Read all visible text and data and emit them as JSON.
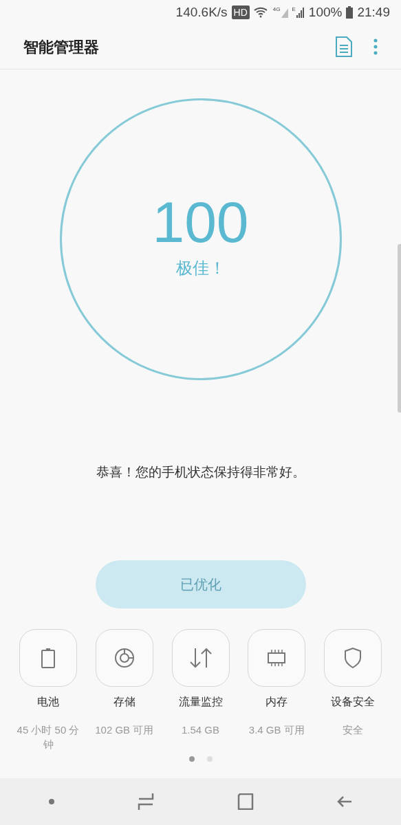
{
  "status_bar": {
    "speed": "140.6K/s",
    "hd": "HD",
    "network": "4G",
    "network_2": "E",
    "battery": "100%",
    "time": "21:49"
  },
  "header": {
    "title": "智能管理器"
  },
  "score": {
    "value": "100",
    "rating": "极佳！"
  },
  "message": "恭喜！您的手机状态保持得非常好。",
  "optimize_button": {
    "label": "已优化",
    "disabled": true
  },
  "tiles": [
    {
      "kind": "battery",
      "label": "电池",
      "detail": "45 小时 50 分钟"
    },
    {
      "kind": "storage",
      "label": "存储",
      "detail": "102 GB 可用"
    },
    {
      "kind": "data",
      "label": "流量监控",
      "detail": "1.54 GB"
    },
    {
      "kind": "memory",
      "label": "内存",
      "detail": "3.4 GB 可用"
    },
    {
      "kind": "security",
      "label": "设备安全",
      "detail": "安全"
    }
  ],
  "pages": [
    {
      "selected": true
    },
    {
      "selected": false
    }
  ]
}
